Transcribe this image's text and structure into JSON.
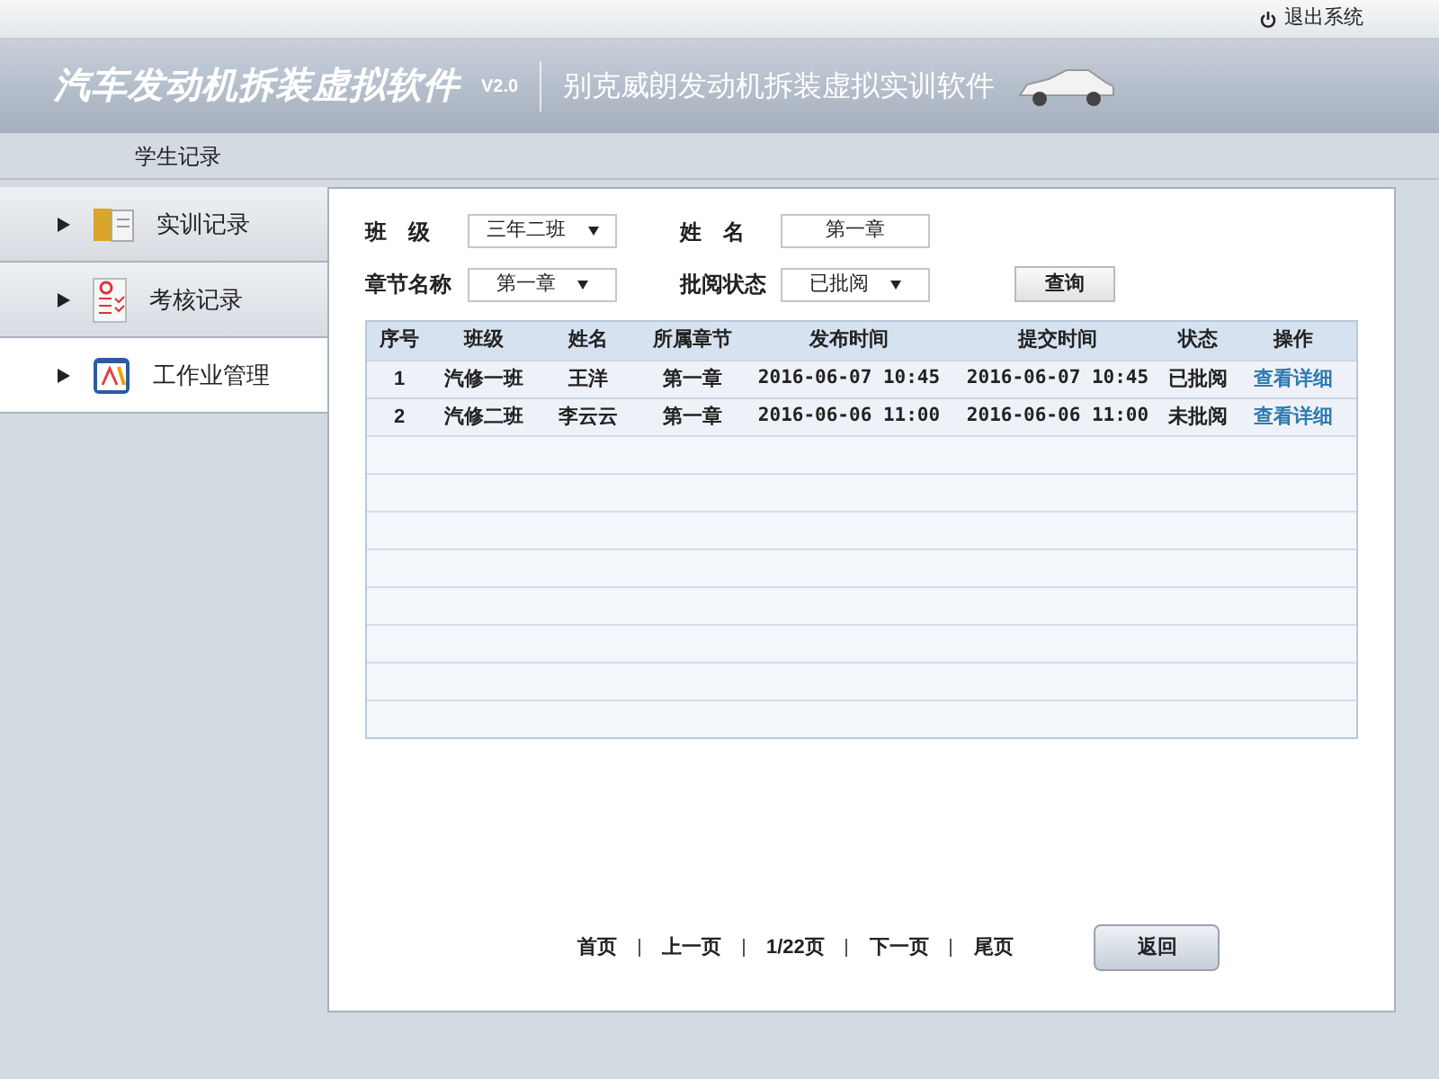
{
  "top_bar": {
    "logout": "退出系统"
  },
  "banner": {
    "title": "汽车发动机拆装虚拟软件",
    "version": "V2.0",
    "subtitle": "别克威朗发动机拆装虚拟实训软件"
  },
  "section_title": "学生记录",
  "sidebar": {
    "items": [
      {
        "label": "实训记录",
        "kind": "book",
        "selected": false
      },
      {
        "label": "考核记录",
        "kind": "checklist",
        "selected": false
      },
      {
        "label": "工作业管理",
        "kind": "pencil",
        "selected": true
      }
    ]
  },
  "filters": [
    {
      "label": "班　级",
      "value": "三年二班",
      "kind": "select"
    },
    {
      "label": "姓　名",
      "value": "第一章",
      "kind": "input"
    },
    {
      "label": "章节名称",
      "value": "第一章",
      "kind": "select"
    },
    {
      "label": "批阅状态",
      "value": "已批阅",
      "kind": "select"
    }
  ],
  "query_button": "查询",
  "table": {
    "columns": [
      "序号",
      "班级",
      "姓名",
      "所属章节",
      "发布时间",
      "提交时间",
      "状态",
      "操作"
    ],
    "rows": [
      {
        "cells": [
          "1",
          "汽修一班",
          "王洋",
          "第一章",
          "2016-06-07 10:45",
          "2016-06-07 10:45",
          "已批阅"
        ],
        "action": "查看详细"
      },
      {
        "cells": [
          "2",
          "汽修二班",
          "李云云",
          "第一章",
          "2016-06-06 11:00",
          "2016-06-06 11:00",
          "未批阅"
        ],
        "action": "查看详细"
      }
    ]
  },
  "pagination": [
    "首页",
    "上一页",
    "1/22页",
    "下一页",
    "尾页"
  ],
  "back_button": "返回"
}
